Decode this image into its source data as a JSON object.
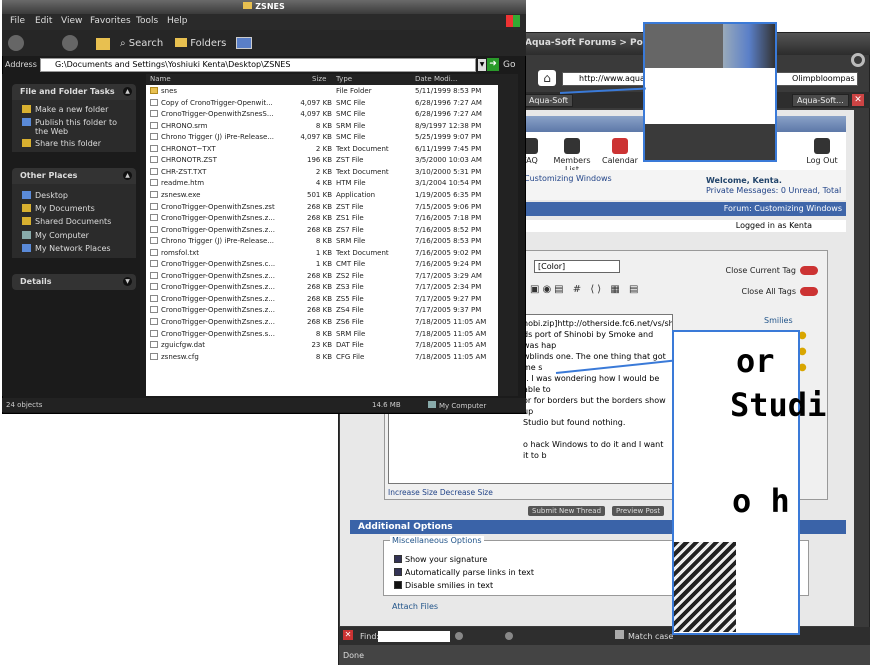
{
  "browser": {
    "title": "Aqua-Soft Forums > Post New",
    "address": "http://www.aqua-soft",
    "search": "Olimpbloompas",
    "tabs": [
      "Aqua-Soft",
      "Aqua-Soft..."
    ],
    "site_title": "Aqua-Soft.org",
    "nav": [
      "FAQ",
      "Members List",
      "Calendar",
      "New Posts",
      "Log Out"
    ],
    "breadcrumb": "Customizing Windows",
    "welcome": "Welcome, Kenta.",
    "private_messages": "Private Messages: 0 Unread, Total 15.",
    "forum_bar": "Forum: Customizing Windows",
    "logged_in": "Logged in as Kenta",
    "color_select": "[Color]",
    "close_current_tag": "Close Current Tag",
    "close_all_tags": "Close All Tags",
    "smilies": "Smilies",
    "message_lines": [
      "nobi.zip]http://otherside.fc6.net/vs/shinobi.zip[/URL]",
      "",
      "ds port of Shinobi by Smoke and was hap",
      "wblinds one. The one thing that got me s",
      "t. I was wondering how I would be able to",
      "or for borders but the borders show up",
      "Studio but found nothing.",
      "",
      "o hack Windows to do it and I want it to b"
    ],
    "size_links": "Increase Size Decrease Size",
    "submit_button": "Submit New Thread",
    "preview_button": "Preview Post",
    "additional_options": "Additional Options",
    "misc_options": "Miscellaneous Options",
    "options": [
      "Show your signature",
      "Automatically parse links in text",
      "Disable smilies in text"
    ],
    "attach_files": "Attach Files",
    "find_label": "Find:",
    "match_case": "Match case",
    "status": "Done"
  },
  "explorer": {
    "title": "ZSNES",
    "menu": [
      "File",
      "Edit",
      "View",
      "Favorites",
      "Tools",
      "Help"
    ],
    "toolbar": {
      "search": "Search",
      "folders": "Folders"
    },
    "address_label": "Address",
    "address": "G:\\Documents and Settings\\Yoshiuki Kenta\\Desktop\\ZSNES",
    "go": "Go",
    "tasks_header": "File and Folder Tasks",
    "tasks": [
      "Make a new folder",
      "Publish this folder to the Web",
      "Share this folder"
    ],
    "places_header": "Other Places",
    "places": [
      "Desktop",
      "My Documents",
      "Shared Documents",
      "My Computer",
      "My Network Places"
    ],
    "details_header": "Details",
    "columns": [
      "Name",
      "Size",
      "Type",
      "Date Modi..."
    ],
    "files": [
      [
        "snes",
        "",
        "File Folder",
        "5/11/1999 8:53 PM",
        "folder"
      ],
      [
        "Copy of CronoTrigger-Openwit...",
        "4,097 KB",
        "SMC File",
        "6/28/1996 7:27 AM",
        "file"
      ],
      [
        "CronoTrigger-OpenwithZsnesS...",
        "4,097 KB",
        "SMC File",
        "6/28/1996 7:27 AM",
        "file"
      ],
      [
        "CHRONO.srm",
        "8 KB",
        "SRM File",
        "8/9/1997 12:38 PM",
        "file"
      ],
      [
        "Chrono Trigger (J) iPre-Release...",
        "4,097 KB",
        "SMC File",
        "5/25/1999 9:07 PM",
        "file"
      ],
      [
        "CHRONOT~TXT",
        "2 KB",
        "Text Document",
        "6/11/1999 7:45 PM",
        "file"
      ],
      [
        "CHRONOTR.ZST",
        "196 KB",
        "ZST File",
        "3/5/2000 10:03 AM",
        "file"
      ],
      [
        "CHR-ZST.TXT",
        "2 KB",
        "Text Document",
        "3/10/2000 5:31 PM",
        "file"
      ],
      [
        "readme.htm",
        "4 KB",
        "HTM File",
        "3/1/2004 10:54 PM",
        "file"
      ],
      [
        "zsnesw.exe",
        "501 KB",
        "Application",
        "1/19/2005 6:35 PM",
        "file"
      ],
      [
        "CronoTrigger-OpenwithZsnes.zst",
        "268 KB",
        "ZST File",
        "7/15/2005 9:06 PM",
        "file"
      ],
      [
        "CronoTrigger-OpenwithZsnes.z...",
        "268 KB",
        "ZS1 File",
        "7/16/2005 7:18 PM",
        "file"
      ],
      [
        "CronoTrigger-OpenwithZsnes.z...",
        "268 KB",
        "ZS7 File",
        "7/16/2005 8:52 PM",
        "file"
      ],
      [
        "Chrono Trigger (J) iPre-Release...",
        "8 KB",
        "SRM File",
        "7/16/2005 8:53 PM",
        "file"
      ],
      [
        "romsfol.txt",
        "1 KB",
        "Text Document",
        "7/16/2005 9:02 PM",
        "file"
      ],
      [
        "CronoTrigger-OpenwithZsnes.c...",
        "1 KB",
        "CMT File",
        "7/16/2005 9:24 PM",
        "file"
      ],
      [
        "CronoTrigger-OpenwithZsnes.z...",
        "268 KB",
        "ZS2 File",
        "7/17/2005 3:29 AM",
        "file"
      ],
      [
        "CronoTrigger-OpenwithZsnes.z...",
        "268 KB",
        "ZS3 File",
        "7/17/2005 2:34 PM",
        "file"
      ],
      [
        "CronoTrigger-OpenwithZsnes.z...",
        "268 KB",
        "ZS5 File",
        "7/17/2005 9:27 PM",
        "file"
      ],
      [
        "CronoTrigger-OpenwithZsnes.z...",
        "268 KB",
        "ZS4 File",
        "7/17/2005 9:37 PM",
        "file"
      ],
      [
        "CronoTrigger-OpenwithZsnes.z...",
        "268 KB",
        "ZS6 File",
        "7/18/2005 11:05 AM",
        "file"
      ],
      [
        "CronoTrigger-OpenwithZsnes.s...",
        "8 KB",
        "SRM File",
        "7/18/2005 11:05 AM",
        "file"
      ],
      [
        "zguicfgw.dat",
        "23 KB",
        "DAT File",
        "7/18/2005 11:05 AM",
        "file"
      ],
      [
        "zsnesw.cfg",
        "8 KB",
        "CFG File",
        "7/18/2005 11:05 AM",
        "file"
      ]
    ],
    "status_objects": "24 objects",
    "status_size": "14.6 MB",
    "status_location": "My Computer"
  },
  "zoom": {
    "lines": [
      "or",
      "Studi",
      "o h"
    ]
  }
}
